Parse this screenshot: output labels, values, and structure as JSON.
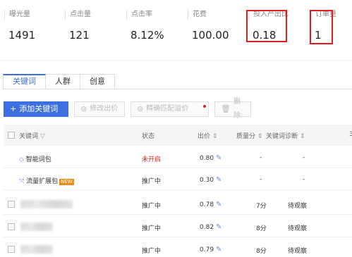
{
  "stats": [
    {
      "label": "曝光量",
      "value": "1491"
    },
    {
      "label": "点击量",
      "value": "121"
    },
    {
      "label": "点击率",
      "value": "8.12%"
    },
    {
      "label": "花费",
      "value": "100.00"
    },
    {
      "label": "投入产出比",
      "value": "0.18"
    },
    {
      "label": "订单量",
      "value": "1"
    }
  ],
  "tabs": [
    "关键词",
    "人群",
    "创意"
  ],
  "toolbar": {
    "add": "添加关键词",
    "edit_bid": "修改出价",
    "precise_bid": "精确匹配溢价",
    "delete": "删除"
  },
  "table": {
    "headers": {
      "keyword": "关键词",
      "status": "状态",
      "bid": "出价",
      "quality": "质量分",
      "diagnosis": "关键词诊断",
      "more": "3"
    },
    "rows": [
      {
        "keyword": "智能词包",
        "status": "未开启",
        "bid": "0.80",
        "quality": "-",
        "diagnosis": "-"
      },
      {
        "keyword": "流量扩展包",
        "tag": "NEW",
        "status": "推广中",
        "bid": "0.30",
        "quality": "-",
        "diagnosis": "-"
      },
      {
        "status": "推广中",
        "bid": "0.78",
        "quality": "7分",
        "diagnosis": "待观察"
      },
      {
        "status": "推广中",
        "bid": "0.82",
        "quality": "8分",
        "diagnosis": "待观察"
      },
      {
        "status": "推广中",
        "bid": "0.79",
        "quality": "8分",
        "diagnosis": "待观察"
      }
    ]
  },
  "colors": {
    "accent": "#3d6fe2",
    "highlight": "#e21c1c",
    "new_tag": "#f08c1a"
  }
}
